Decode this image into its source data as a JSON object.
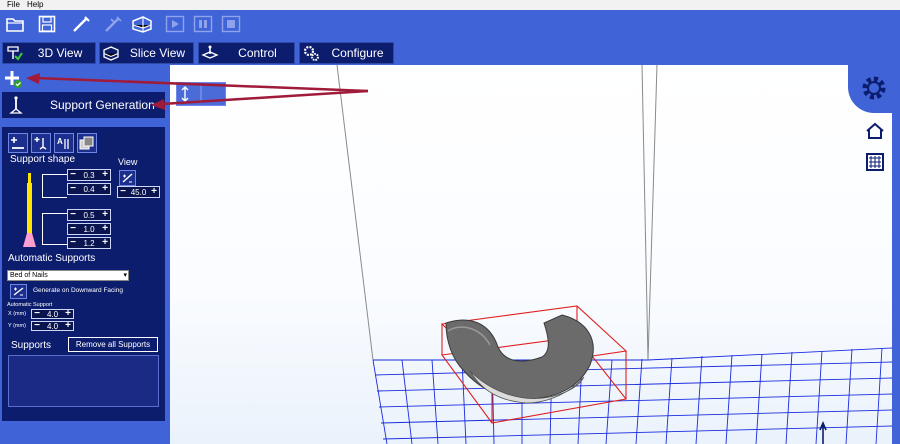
{
  "menu": {
    "file": "File",
    "help": "Help"
  },
  "toolbar": {
    "buttons": [
      "open-icon",
      "save-icon",
      "wand-icon",
      "wand-disabled-icon",
      "slice-stack-icon",
      "play-icon",
      "pause-icon",
      "stop-icon"
    ]
  },
  "tabs": [
    {
      "label": "3D View",
      "icon": "model-view-icon"
    },
    {
      "label": "Slice View",
      "icon": "slice-view-icon"
    },
    {
      "label": "Control",
      "icon": "control-icon"
    },
    {
      "label": "Configure",
      "icon": "configure-gear-icon"
    }
  ],
  "panel": {
    "title": "Support Generation",
    "support_shape_label": "Support shape",
    "view_label": "View",
    "shape_values": [
      "0.3",
      "0.4",
      "0.5",
      "1.0",
      "1.2"
    ],
    "view_angle": "45.0",
    "automatic_supports_label": "Automatic Supports",
    "auto_mode": "Bed of Nails",
    "generate_label": "Generate on Downward Facing",
    "auto_support_label": "Automatic Support",
    "x_label": "X (mm)",
    "x_value": "4.0",
    "y_label": "Y (mm)",
    "y_value": "4.0",
    "supports_label": "Supports",
    "remove_all_label": "Remove all Supports"
  },
  "colors": {
    "toolbar_bg": "#4063d8",
    "panel_bg": "#0d1d6e",
    "annotation_arrow": "#a01a3a",
    "grid": "#1a2be0",
    "bounding_box": "#e02020"
  }
}
